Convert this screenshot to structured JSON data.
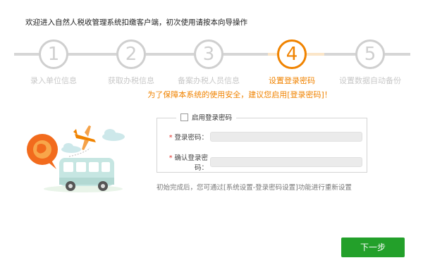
{
  "header": {
    "title": "欢迎进入自然人税收管理系统扣缴客户端，初次使用请按本向导操作"
  },
  "steps": [
    {
      "number": "1",
      "label": "录入单位信息"
    },
    {
      "number": "2",
      "label": "获取办税信息"
    },
    {
      "number": "3",
      "label": "备案办税人员信息"
    },
    {
      "number": "4",
      "label": "设置登录密码"
    },
    {
      "number": "5",
      "label": "设置数据自动备份"
    }
  ],
  "active_step": 4,
  "hint": "为了保障本系统的使用安全，建议您启用[登录密码]！",
  "form": {
    "enable_label": "启用登录密码",
    "enable_checked": false,
    "password_label": "登录密码：",
    "password_value": "",
    "confirm_label": "确认登录密码：",
    "confirm_value": "",
    "required_mark": "*"
  },
  "note": "初始完成后，您可通过[系统设置-登录密码设置]功能进行重新设置",
  "actions": {
    "next_label": "下一步"
  },
  "colors": {
    "accent": "#f08300",
    "primary_button": "#23a02a",
    "inactive": "#cfcfcf"
  }
}
